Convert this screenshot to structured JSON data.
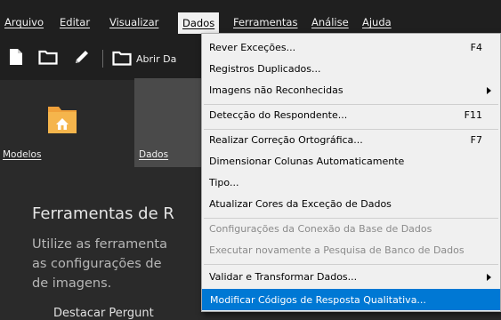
{
  "menubar": {
    "items": [
      {
        "label": "Arquivo"
      },
      {
        "label": "Editar"
      },
      {
        "label": "Visualizar"
      },
      {
        "label": "Dados"
      },
      {
        "label": "Ferramentas"
      },
      {
        "label": "Análise"
      },
      {
        "label": "Ajuda"
      }
    ],
    "active_index": 3
  },
  "toolbar": {
    "open_label": "Abrir Da",
    "icons": [
      "new-file-icon",
      "folder-icon",
      "pencil-icon",
      "folder-icon"
    ]
  },
  "tiles": [
    {
      "label": "Modelos",
      "icon": "house-folder-icon"
    },
    {
      "label": "Dados"
    }
  ],
  "content": {
    "heading": "Ferramentas de R",
    "paragraph_lines": [
      "Utilize as ferramenta",
      "as configurações de",
      "de imagens."
    ],
    "cut_text": "Destacar Pergunt"
  },
  "dropdown": {
    "items": [
      {
        "label": "Rever Exceções...",
        "shortcut": "F4"
      },
      {
        "label": "Registros Duplicados..."
      },
      {
        "label": "Imagens não Reconhecidas",
        "submenu": true
      },
      {
        "label": "Detecção do Respondente...",
        "shortcut": "F11"
      },
      {
        "label": "Realizar Correção Ortográfica...",
        "shortcut": "F7"
      },
      {
        "label": "Dimensionar Colunas Automaticamente"
      },
      {
        "label": "Tipo..."
      },
      {
        "label": "Atualizar Cores da Exceção de Dados"
      },
      {
        "label": "Configurações da Conexão da Base de Dados",
        "disabled": true
      },
      {
        "label": "Executar novamente a Pesquisa de Banco de Dados",
        "disabled": true
      },
      {
        "label": "Validar e Transformar Dados...",
        "submenu": true
      },
      {
        "label": "Modificar Códigos de Resposta Qualitativa...",
        "highlighted": true
      }
    ]
  },
  "colors": {
    "menubar_bg": "#1f1f1f",
    "content_bg": "#2a2a2a",
    "menu_bg": "#f0f0f0",
    "highlight": "#0078d4",
    "accent_orange": "#f0a13a"
  }
}
